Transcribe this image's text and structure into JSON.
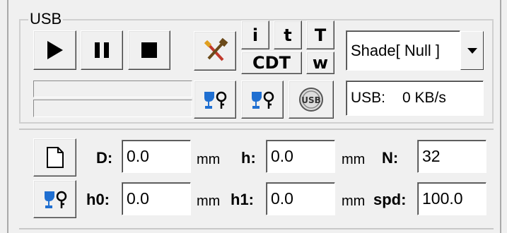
{
  "usb_group": {
    "title": "USB",
    "buttons": {
      "play": "play-icon",
      "pause": "pause-icon",
      "stop": "stop-icon",
      "tools": "tools-icon",
      "i_label": "i",
      "t_label": "t",
      "T_label": "T",
      "cdt_label": "CDT",
      "w_label": "w",
      "key_left": "key-icon",
      "key_right": "key-icon",
      "usb_round": "usb-icon"
    },
    "shade_select": {
      "value": "Shade[ Null ]"
    },
    "usb_speed": {
      "prefix": "USB:",
      "value": "0 KB/s"
    }
  },
  "params": {
    "D": {
      "label": "D:",
      "value": "0.0",
      "unit": "mm"
    },
    "h": {
      "label": "h:",
      "value": "0.0",
      "unit": "mm"
    },
    "N": {
      "label": "N:",
      "value": "32"
    },
    "h0": {
      "label": "h0:",
      "value": "0.0",
      "unit": "mm"
    },
    "h1": {
      "label": "h1:",
      "value": "0.0",
      "unit": "mm"
    },
    "spd": {
      "label": "spd:",
      "value": "100.0"
    }
  },
  "colors": {
    "window_bg": "#f0f0f0",
    "key_blue": "#1f6fd1"
  }
}
